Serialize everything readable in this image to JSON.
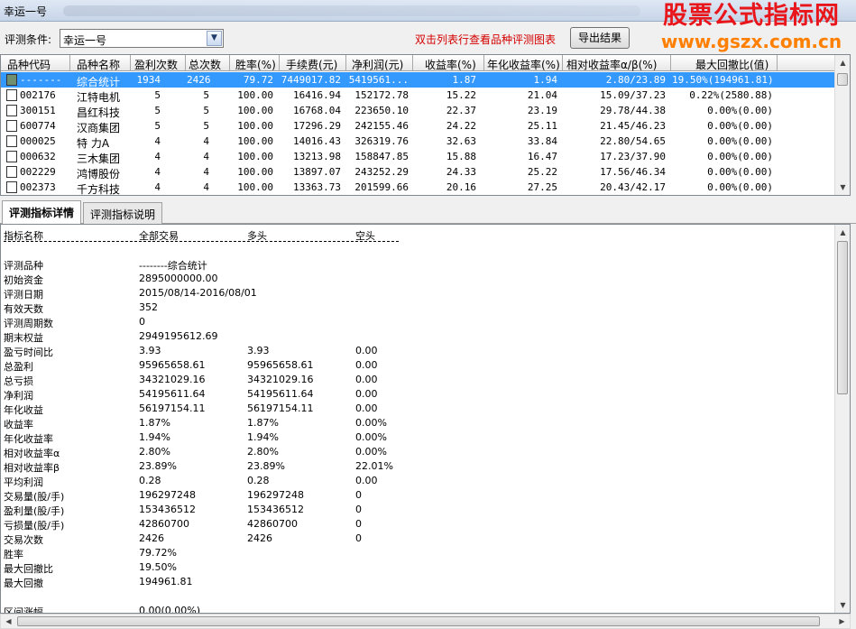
{
  "window": {
    "title": "幸运一号"
  },
  "watermark": {
    "line1": "股票公式指标网",
    "line2": "www.gszx.com.cn"
  },
  "criteria": {
    "label": "评测条件:",
    "selected": "幸运一号",
    "hint": "双击列表行查看品种评测图表",
    "export_label": "导出结果"
  },
  "grid": {
    "columns": [
      "品种代码",
      "品种名称",
      "盈利次数",
      "总次数",
      "胜率(%)",
      "手续费(元)",
      "净利润(元)",
      "收益率(%)",
      "年化收益率(%)",
      "相对收益率α/β(%)",
      "最大回撤比(值)"
    ],
    "rows": [
      {
        "code": "-------",
        "name": "综合统计",
        "wins": "1934",
        "total": "2426",
        "winrate": "79.72",
        "fee": "7449017.82",
        "profit": "5419561...",
        "ret": "1.87",
        "annual": "1.94",
        "relative": "2.80/23.89",
        "drawdown": "19.50%(194961.81)",
        "selected": true
      },
      {
        "code": "002176",
        "name": "江特电机",
        "wins": "5",
        "total": "5",
        "winrate": "100.00",
        "fee": "16416.94",
        "profit": "152172.78",
        "ret": "15.22",
        "annual": "21.04",
        "relative": "15.09/37.23",
        "drawdown": "0.22%(2580.88)"
      },
      {
        "code": "300151",
        "name": "昌红科技",
        "wins": "5",
        "total": "5",
        "winrate": "100.00",
        "fee": "16768.04",
        "profit": "223650.10",
        "ret": "22.37",
        "annual": "23.19",
        "relative": "29.78/44.38",
        "drawdown": "0.00%(0.00)"
      },
      {
        "code": "600774",
        "name": "汉商集团",
        "wins": "5",
        "total": "5",
        "winrate": "100.00",
        "fee": "17296.29",
        "profit": "242155.46",
        "ret": "24.22",
        "annual": "25.11",
        "relative": "21.45/46.23",
        "drawdown": "0.00%(0.00)"
      },
      {
        "code": "000025",
        "name": "特 力A",
        "wins": "4",
        "total": "4",
        "winrate": "100.00",
        "fee": "14016.43",
        "profit": "326319.76",
        "ret": "32.63",
        "annual": "33.84",
        "relative": "22.80/54.65",
        "drawdown": "0.00%(0.00)"
      },
      {
        "code": "000632",
        "name": "三木集团",
        "wins": "4",
        "total": "4",
        "winrate": "100.00",
        "fee": "13213.98",
        "profit": "158847.85",
        "ret": "15.88",
        "annual": "16.47",
        "relative": "17.23/37.90",
        "drawdown": "0.00%(0.00)"
      },
      {
        "code": "002229",
        "name": "鸿博股份",
        "wins": "4",
        "total": "4",
        "winrate": "100.00",
        "fee": "13897.07",
        "profit": "243252.29",
        "ret": "24.33",
        "annual": "25.22",
        "relative": "17.56/46.34",
        "drawdown": "0.00%(0.00)"
      },
      {
        "code": "002373",
        "name": "千方科技",
        "wins": "4",
        "total": "4",
        "winrate": "100.00",
        "fee": "13363.73",
        "profit": "201599.66",
        "ret": "20.16",
        "annual": "27.25",
        "relative": "20.43/42.17",
        "drawdown": "0.00%(0.00)"
      }
    ]
  },
  "tabs": [
    {
      "label": "评测指标详情",
      "active": true
    },
    {
      "label": "评测指标说明",
      "active": false
    }
  ],
  "detail": {
    "headers": [
      "指标名称",
      "全部交易",
      "多头",
      "空头"
    ],
    "rows": [
      {
        "name": "评测品种",
        "all": "--------综合统计",
        "long": "",
        "short": ""
      },
      {
        "name": "初始资金",
        "all": "2895000000.00",
        "long": "",
        "short": ""
      },
      {
        "name": "评测日期",
        "all": "2015/08/14-2016/08/01",
        "long": "",
        "short": ""
      },
      {
        "name": "有效天数",
        "all": "352",
        "long": "",
        "short": ""
      },
      {
        "name": "评测周期数",
        "all": "0",
        "long": "",
        "short": ""
      },
      {
        "name": "期末权益",
        "all": "2949195612.69",
        "long": "",
        "short": ""
      },
      {
        "name": "盈亏时间比",
        "all": "3.93",
        "long": "3.93",
        "short": "0.00"
      },
      {
        "name": "总盈利",
        "all": "95965658.61",
        "long": "95965658.61",
        "short": "0.00"
      },
      {
        "name": "总亏损",
        "all": "34321029.16",
        "long": "34321029.16",
        "short": "0.00"
      },
      {
        "name": "净利润",
        "all": "54195611.64",
        "long": "54195611.64",
        "short": "0.00"
      },
      {
        "name": "年化收益",
        "all": "56197154.11",
        "long": "56197154.11",
        "short": "0.00"
      },
      {
        "name": "收益率",
        "all": "1.87%",
        "long": "1.87%",
        "short": "0.00%"
      },
      {
        "name": "年化收益率",
        "all": "1.94%",
        "long": "1.94%",
        "short": "0.00%"
      },
      {
        "name": "相对收益率α",
        "all": "2.80%",
        "long": "2.80%",
        "short": "0.00%"
      },
      {
        "name": "相对收益率β",
        "all": "23.89%",
        "long": "23.89%",
        "short": "22.01%"
      },
      {
        "name": "平均利润",
        "all": "0.28",
        "long": "0.28",
        "short": "0.00"
      },
      {
        "name": "交易量(股/手)",
        "all": "196297248",
        "long": "196297248",
        "short": "0"
      },
      {
        "name": "盈利量(股/手)",
        "all": "153436512",
        "long": "153436512",
        "short": "0"
      },
      {
        "name": "亏损量(股/手)",
        "all": "42860700",
        "long": "42860700",
        "short": "0"
      },
      {
        "name": "交易次数",
        "all": "2426",
        "long": "2426",
        "short": "0"
      },
      {
        "name": "胜率",
        "all": "79.72%",
        "long": "",
        "short": ""
      },
      {
        "name": "最大回撤比",
        "all": "19.50%",
        "long": "",
        "short": ""
      },
      {
        "name": "最大回撤",
        "all": "194961.81",
        "long": "",
        "short": ""
      },
      {
        "name": "",
        "all": "",
        "long": "",
        "short": ""
      },
      {
        "name": "区间涨幅",
        "all": "0.00(0.00%)",
        "long": "",
        "short": ""
      }
    ]
  },
  "icons": {
    "combo_arrow": "chevron-down-icon",
    "row_checkbox": "checkbox-icon",
    "scroll_up": "arrow-up-icon",
    "scroll_down": "arrow-down-icon",
    "scroll_left": "arrow-left-icon",
    "scroll_right": "arrow-right-icon"
  },
  "colors": {
    "selection": "#3399ff",
    "hint": "#d40000",
    "watermark_primary": "#e8151b",
    "watermark_secondary": "#ff7f00"
  }
}
